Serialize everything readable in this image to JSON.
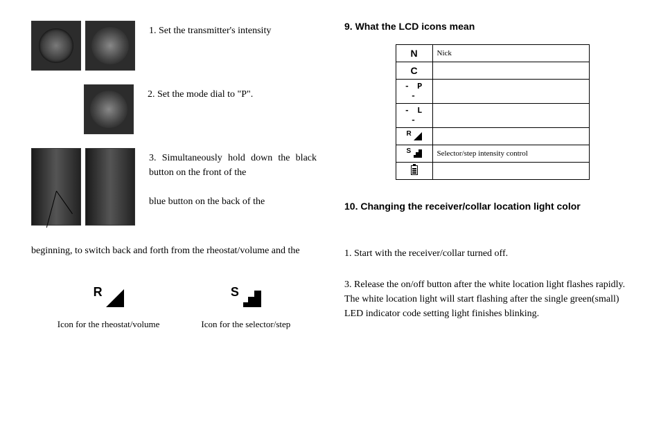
{
  "left": {
    "step1": "1. Set the transmitter's intensity",
    "step2": "2. Set the mode dial to \"P\".",
    "step3a": "3. Simultaneously hold down the black button on the front of the",
    "step3b": "blue button on the back of the",
    "bottom_text": "beginning, to switch back and forth from the rheostat/volume and the",
    "icon_r_caption": "Icon for the rheostat/volume",
    "icon_s_caption": "Icon for the selector/step"
  },
  "right": {
    "heading9": "9. What the LCD icons mean",
    "table": {
      "rows": [
        {
          "icon": "N",
          "desc": "Nick"
        },
        {
          "icon": "C",
          "desc": ""
        },
        {
          "icon": "- P -",
          "desc": ""
        },
        {
          "icon": "- L -",
          "desc": ""
        },
        {
          "icon": "R_TRI",
          "desc": ""
        },
        {
          "icon": "S_STEP",
          "desc": "Selector/step intensity control"
        },
        {
          "icon": "BATT",
          "desc": ""
        }
      ]
    },
    "heading10": "10. Changing the receiver/collar location light color",
    "step1": "1. Start with the receiver/collar turned off.",
    "step3": "3. Release the on/off button after the white location light flashes rapidly. The white location light will start flashing after the single green(small) LED indicator code setting light finishes blinking."
  }
}
